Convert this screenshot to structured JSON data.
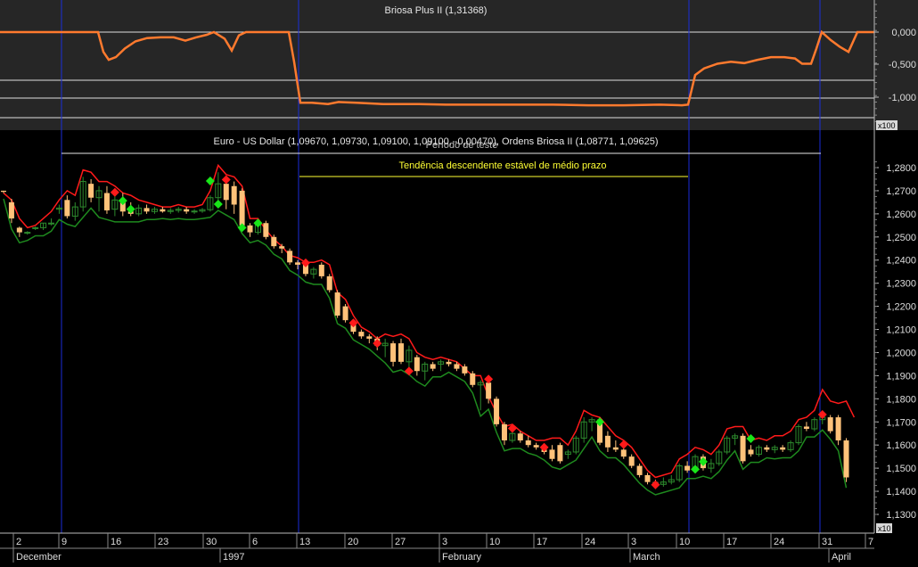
{
  "indicator_panel": {
    "title": "Briosa Plus II (1,31368)",
    "y_ticks": [
      "0,000",
      "-0,500",
      "-1,000"
    ],
    "scale_badge": "x100"
  },
  "price_panel": {
    "title": "Euro - US Dollar (1,09670, 1,09730, 1,09100, 1,09100, -0,00470), Ordens Briosa II (1,08771, 1,09625)",
    "period_label": "Período de teste",
    "trend_label": "Tendência descendente estável de médio prazo",
    "y_ticks": [
      "1,2800",
      "1,2700",
      "1,2600",
      "1,2500",
      "1,2400",
      "1,2300",
      "1,2200",
      "1,2100",
      "1,2000",
      "1,1900",
      "1,1800",
      "1,1700",
      "1,1600",
      "1,1500",
      "1,1400",
      "1,1300"
    ],
    "scale_badge": "x10"
  },
  "x_axis": {
    "day_labels": [
      "2",
      "9",
      "16",
      "23",
      "30",
      "6",
      "13",
      "20",
      "27",
      "3",
      "10",
      "17",
      "24",
      "3",
      "10",
      "17",
      "24",
      "31",
      "7"
    ],
    "month_labels": [
      "December",
      "1997",
      "February",
      "March",
      "April"
    ]
  },
  "colors": {
    "background": "#000000",
    "indicator_bg": "#262626",
    "indicator_line": "#ff7a2e",
    "upper_band": "#ff1a1a",
    "lower_band": "#1e8a1e",
    "candle_down": "#ffc27a",
    "candle_up": "#2d8a2d",
    "buy_signal": "#19e619",
    "sell_signal": "#ff1a1a",
    "vertical_markers": "#1a2dd9",
    "annotation_text": "#ffff33"
  },
  "chart_data": {
    "type": "candlestick",
    "instrument": "Euro - US Dollar",
    "indicator": "Briosa Plus II",
    "ylim_price": [
      1.128,
      1.287
    ],
    "ylim_indicator": [
      -1.3,
      0.12
    ],
    "candles": [
      {
        "o": 1.27,
        "h": 1.27,
        "l": 1.269,
        "c": 1.2695
      },
      {
        "o": 1.265,
        "h": 1.2665,
        "l": 1.256,
        "c": 1.258
      },
      {
        "o": 1.254,
        "h": 1.2545,
        "l": 1.25,
        "c": 1.252
      },
      {
        "o": 1.252,
        "h": 1.2525,
        "l": 1.251,
        "c": 1.252
      },
      {
        "o": 1.254,
        "h": 1.2545,
        "l": 1.253,
        "c": 1.254
      },
      {
        "o": 1.254,
        "h": 1.256,
        "l": 1.253,
        "c": 1.256
      },
      {
        "o": 1.256,
        "h": 1.258,
        "l": 1.255,
        "c": 1.256
      },
      {
        "o": 1.262,
        "h": 1.264,
        "l": 1.26,
        "c": 1.2625
      },
      {
        "o": 1.266,
        "h": 1.268,
        "l": 1.258,
        "c": 1.259
      },
      {
        "o": 1.259,
        "h": 1.265,
        "l": 1.257,
        "c": 1.263
      },
      {
        "o": 1.263,
        "h": 1.276,
        "l": 1.261,
        "c": 1.274
      },
      {
        "o": 1.273,
        "h": 1.275,
        "l": 1.265,
        "c": 1.267
      },
      {
        "o": 1.267,
        "h": 1.272,
        "l": 1.261,
        "c": 1.27
      },
      {
        "o": 1.269,
        "h": 1.272,
        "l": 1.26,
        "c": 1.2615
      },
      {
        "o": 1.262,
        "h": 1.268,
        "l": 1.259,
        "c": 1.266
      },
      {
        "o": 1.266,
        "h": 1.269,
        "l": 1.259,
        "c": 1.261
      },
      {
        "o": 1.261,
        "h": 1.265,
        "l": 1.259,
        "c": 1.26
      },
      {
        "o": 1.26,
        "h": 1.264,
        "l": 1.259,
        "c": 1.2625
      },
      {
        "o": 1.2625,
        "h": 1.264,
        "l": 1.26,
        "c": 1.261
      },
      {
        "o": 1.261,
        "h": 1.263,
        "l": 1.26,
        "c": 1.262
      },
      {
        "o": 1.262,
        "h": 1.263,
        "l": 1.2605,
        "c": 1.261
      },
      {
        "o": 1.261,
        "h": 1.2625,
        "l": 1.26,
        "c": 1.2615
      },
      {
        "o": 1.2615,
        "h": 1.263,
        "l": 1.2605,
        "c": 1.262
      },
      {
        "o": 1.262,
        "h": 1.263,
        "l": 1.26,
        "c": 1.261
      },
      {
        "o": 1.261,
        "h": 1.262,
        "l": 1.26,
        "c": 1.2612
      },
      {
        "o": 1.2612,
        "h": 1.2625,
        "l": 1.2605,
        "c": 1.2618
      },
      {
        "o": 1.2618,
        "h": 1.268,
        "l": 1.261,
        "c": 1.267
      },
      {
        "o": 1.267,
        "h": 1.278,
        "l": 1.264,
        "c": 1.273
      },
      {
        "o": 1.273,
        "h": 1.276,
        "l": 1.262,
        "c": 1.266
      },
      {
        "o": 1.272,
        "h": 1.274,
        "l": 1.26,
        "c": 1.264
      },
      {
        "o": 1.27,
        "h": 1.271,
        "l": 1.254,
        "c": 1.255
      },
      {
        "o": 1.255,
        "h": 1.256,
        "l": 1.25,
        "c": 1.252
      },
      {
        "o": 1.252,
        "h": 1.257,
        "l": 1.251,
        "c": 1.256
      },
      {
        "o": 1.256,
        "h": 1.257,
        "l": 1.249,
        "c": 1.25
      },
      {
        "o": 1.25,
        "h": 1.251,
        "l": 1.245,
        "c": 1.246
      },
      {
        "o": 1.246,
        "h": 1.247,
        "l": 1.243,
        "c": 1.245
      },
      {
        "o": 1.244,
        "h": 1.245,
        "l": 1.238,
        "c": 1.239
      },
      {
        "o": 1.239,
        "h": 1.24,
        "l": 1.236,
        "c": 1.238
      },
      {
        "o": 1.238,
        "h": 1.239,
        "l": 1.233,
        "c": 1.234
      },
      {
        "o": 1.234,
        "h": 1.237,
        "l": 1.232,
        "c": 1.236
      },
      {
        "o": 1.238,
        "h": 1.239,
        "l": 1.232,
        "c": 1.233
      },
      {
        "o": 1.233,
        "h": 1.234,
        "l": 1.226,
        "c": 1.227
      },
      {
        "o": 1.226,
        "h": 1.227,
        "l": 1.215,
        "c": 1.216
      },
      {
        "o": 1.22,
        "h": 1.221,
        "l": 1.213,
        "c": 1.214
      },
      {
        "o": 1.212,
        "h": 1.214,
        "l": 1.208,
        "c": 1.209
      },
      {
        "o": 1.209,
        "h": 1.21,
        "l": 1.206,
        "c": 1.207
      },
      {
        "o": 1.207,
        "h": 1.208,
        "l": 1.204,
        "c": 1.206
      },
      {
        "o": 1.206,
        "h": 1.207,
        "l": 1.201,
        "c": 1.203
      },
      {
        "o": 1.203,
        "h": 1.206,
        "l": 1.198,
        "c": 1.204
      },
      {
        "o": 1.204,
        "h": 1.205,
        "l": 1.194,
        "c": 1.196
      },
      {
        "o": 1.204,
        "h": 1.206,
        "l": 1.195,
        "c": 1.196
      },
      {
        "o": 1.196,
        "h": 1.203,
        "l": 1.193,
        "c": 1.201
      },
      {
        "o": 1.198,
        "h": 1.199,
        "l": 1.19,
        "c": 1.192
      },
      {
        "o": 1.192,
        "h": 1.196,
        "l": 1.188,
        "c": 1.195
      },
      {
        "o": 1.195,
        "h": 1.196,
        "l": 1.192,
        "c": 1.193
      },
      {
        "o": 1.195,
        "h": 1.197,
        "l": 1.192,
        "c": 1.196
      },
      {
        "o": 1.196,
        "h": 1.197,
        "l": 1.194,
        "c": 1.195
      },
      {
        "o": 1.195,
        "h": 1.196,
        "l": 1.192,
        "c": 1.193
      },
      {
        "o": 1.194,
        "h": 1.195,
        "l": 1.19,
        "c": 1.191
      },
      {
        "o": 1.191,
        "h": 1.192,
        "l": 1.185,
        "c": 1.186
      },
      {
        "o": 1.186,
        "h": 1.188,
        "l": 1.175,
        "c": 1.187
      },
      {
        "o": 1.187,
        "h": 1.188,
        "l": 1.178,
        "c": 1.18
      },
      {
        "o": 1.18,
        "h": 1.181,
        "l": 1.168,
        "c": 1.169
      },
      {
        "o": 1.169,
        "h": 1.17,
        "l": 1.16,
        "c": 1.162
      },
      {
        "o": 1.162,
        "h": 1.166,
        "l": 1.161,
        "c": 1.165
      },
      {
        "o": 1.165,
        "h": 1.166,
        "l": 1.161,
        "c": 1.162
      },
      {
        "o": 1.162,
        "h": 1.164,
        "l": 1.159,
        "c": 1.16
      },
      {
        "o": 1.16,
        "h": 1.161,
        "l": 1.158,
        "c": 1.159
      },
      {
        "o": 1.158,
        "h": 1.16,
        "l": 1.156,
        "c": 1.157
      },
      {
        "o": 1.158,
        "h": 1.16,
        "l": 1.153,
        "c": 1.154
      },
      {
        "o": 1.16,
        "h": 1.161,
        "l": 1.152,
        "c": 1.153
      },
      {
        "o": 1.156,
        "h": 1.158,
        "l": 1.154,
        "c": 1.157
      },
      {
        "o": 1.157,
        "h": 1.164,
        "l": 1.156,
        "c": 1.163
      },
      {
        "o": 1.163,
        "h": 1.172,
        "l": 1.161,
        "c": 1.17
      },
      {
        "o": 1.17,
        "h": 1.172,
        "l": 1.166,
        "c": 1.171
      },
      {
        "o": 1.171,
        "h": 1.172,
        "l": 1.16,
        "c": 1.161
      },
      {
        "o": 1.164,
        "h": 1.166,
        "l": 1.157,
        "c": 1.159
      },
      {
        "o": 1.159,
        "h": 1.162,
        "l": 1.157,
        "c": 1.158
      },
      {
        "o": 1.158,
        "h": 1.159,
        "l": 1.154,
        "c": 1.155
      },
      {
        "o": 1.155,
        "h": 1.156,
        "l": 1.15,
        "c": 1.151
      },
      {
        "o": 1.151,
        "h": 1.152,
        "l": 1.146,
        "c": 1.147
      },
      {
        "o": 1.147,
        "h": 1.148,
        "l": 1.143,
        "c": 1.144
      },
      {
        "o": 1.144,
        "h": 1.145,
        "l": 1.141,
        "c": 1.143
      },
      {
        "o": 1.143,
        "h": 1.146,
        "l": 1.142,
        "c": 1.144
      },
      {
        "o": 1.144,
        "h": 1.147,
        "l": 1.143,
        "c": 1.145
      },
      {
        "o": 1.145,
        "h": 1.152,
        "l": 1.144,
        "c": 1.151
      },
      {
        "o": 1.151,
        "h": 1.153,
        "l": 1.148,
        "c": 1.149
      },
      {
        "o": 1.149,
        "h": 1.156,
        "l": 1.148,
        "c": 1.155
      },
      {
        "o": 1.155,
        "h": 1.156,
        "l": 1.149,
        "c": 1.15
      },
      {
        "o": 1.15,
        "h": 1.154,
        "l": 1.148,
        "c": 1.152
      },
      {
        "o": 1.152,
        "h": 1.158,
        "l": 1.151,
        "c": 1.157
      },
      {
        "o": 1.157,
        "h": 1.164,
        "l": 1.156,
        "c": 1.163
      },
      {
        "o": 1.163,
        "h": 1.165,
        "l": 1.16,
        "c": 1.164
      },
      {
        "o": 1.164,
        "h": 1.165,
        "l": 1.152,
        "c": 1.153
      },
      {
        "o": 1.158,
        "h": 1.16,
        "l": 1.155,
        "c": 1.156
      },
      {
        "o": 1.156,
        "h": 1.16,
        "l": 1.155,
        "c": 1.159
      },
      {
        "o": 1.159,
        "h": 1.16,
        "l": 1.157,
        "c": 1.158
      },
      {
        "o": 1.158,
        "h": 1.16,
        "l": 1.1565,
        "c": 1.159
      },
      {
        "o": 1.159,
        "h": 1.16,
        "l": 1.157,
        "c": 1.158
      },
      {
        "o": 1.158,
        "h": 1.162,
        "l": 1.157,
        "c": 1.161
      },
      {
        "o": 1.161,
        "h": 1.169,
        "l": 1.16,
        "c": 1.168
      },
      {
        "o": 1.168,
        "h": 1.17,
        "l": 1.166,
        "c": 1.167
      },
      {
        "o": 1.167,
        "h": 1.172,
        "l": 1.166,
        "c": 1.171
      },
      {
        "o": 1.171,
        "h": 1.174,
        "l": 1.169,
        "c": 1.172
      },
      {
        "o": 1.172,
        "h": 1.173,
        "l": 1.165,
        "c": 1.166
      },
      {
        "o": 1.172,
        "h": 1.173,
        "l": 1.16,
        "c": 1.162
      },
      {
        "o": 1.162,
        "h": 1.163,
        "l": 1.144,
        "c": 1.146
      }
    ],
    "upper_band": [
      1.269,
      1.266,
      1.258,
      1.254,
      1.255,
      1.258,
      1.261,
      1.266,
      1.27,
      1.268,
      1.279,
      1.278,
      1.274,
      1.274,
      1.272,
      1.269,
      1.268,
      1.266,
      1.265,
      1.264,
      1.263,
      1.263,
      1.264,
      1.263,
      1.263,
      1.264,
      1.27,
      1.281,
      1.277,
      1.276,
      1.272,
      1.258,
      1.258,
      1.253,
      1.249,
      1.246,
      1.242,
      1.241,
      1.239,
      1.239,
      1.24,
      1.238,
      1.226,
      1.223,
      1.216,
      1.211,
      1.209,
      1.206,
      1.208,
      1.207,
      1.208,
      1.206,
      1.2,
      1.198,
      1.197,
      1.198,
      1.197,
      1.196,
      1.193,
      1.19,
      1.19,
      1.181,
      1.174,
      1.168,
      1.169,
      1.166,
      1.164,
      1.162,
      1.162,
      1.163,
      1.163,
      1.16,
      1.166,
      1.175,
      1.173,
      1.172,
      1.168,
      1.164,
      1.162,
      1.159,
      1.154,
      1.149,
      1.146,
      1.147,
      1.148,
      1.154,
      1.156,
      1.159,
      1.158,
      1.156,
      1.16,
      1.167,
      1.168,
      1.168,
      1.162,
      1.163,
      1.162,
      1.164,
      1.164,
      1.166,
      1.171,
      1.172,
      1.175,
      1.184,
      1.179,
      1.178,
      1.179,
      1.172
    ]
  }
}
